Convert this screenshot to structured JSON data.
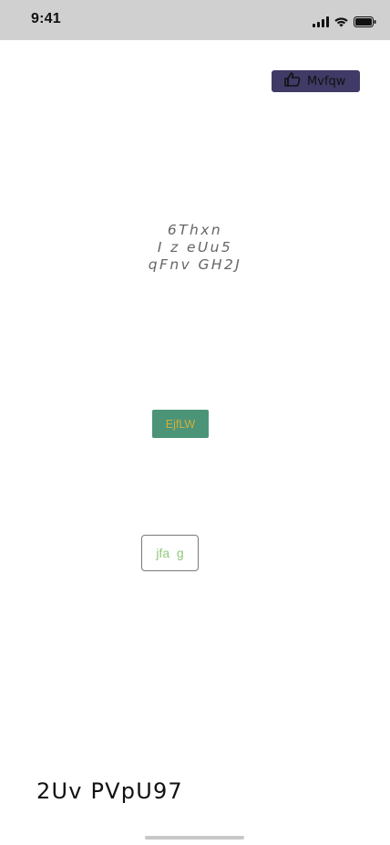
{
  "status_bar": {
    "time": "9:41",
    "icons": [
      "cellular-signal-icon",
      "wifi-icon",
      "battery-icon"
    ]
  },
  "like_button": {
    "label": "Mvfqw",
    "icon": "thumbs-up-icon",
    "background": "#3f3a66"
  },
  "text_block": {
    "lines": [
      "6Thxn",
      "I z eUu5",
      "qFnv GH2J"
    ]
  },
  "green_button": {
    "label": "EjfLW",
    "background": "#4c9478",
    "text_color": "#cbb03e"
  },
  "outline_button": {
    "label": "jfa  g",
    "text_color": "#93c87a"
  },
  "bottom_text": "2Uv PVpU97",
  "colors": {
    "status_bar_bg": "#d0d0d0",
    "page_bg": "#ffffff"
  }
}
